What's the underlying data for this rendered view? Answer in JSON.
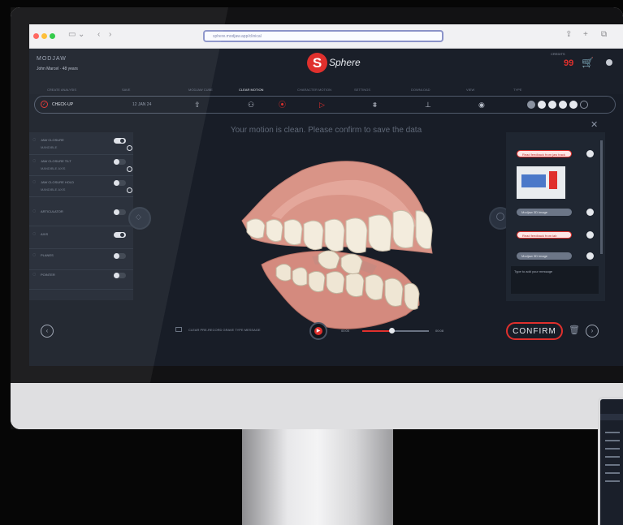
{
  "browser": {
    "url": "sphere.modjaw.app/clinical",
    "nav_icons": {
      "sidebar": "sidebar-icon",
      "back": "chevron-left-icon",
      "forward": "chevron-right-icon"
    },
    "right_icons": [
      "share-icon",
      "new-tab-icon",
      "tabs-icon"
    ],
    "glyphs": {
      "sidebar": "▭",
      "back": "‹",
      "forward": "›",
      "share": "⇪",
      "new_tab": "+",
      "tabs": "⧉"
    }
  },
  "app": {
    "brand": "MODJAW",
    "patient": "John Marcel · 48 years",
    "logo_letter": "S",
    "logo_text": "Sphere",
    "counter_label": "CREDITS",
    "counter_value": "99",
    "cart_glyph": "🛒",
    "accent_color": "#e0302d"
  },
  "steps": {
    "labels": [
      "CREATE ANALYSIS",
      "SAVE",
      "MODJAW CUBE",
      "CLEAR MOTION",
      "CHARACTER MOTION",
      "SETTINGS",
      "DOWNLOAD",
      "VIEW",
      "TYPE"
    ],
    "active_index": 3,
    "current": "CHECK-UP",
    "date": "12 JAN 24",
    "icons": [
      "upload-icon",
      "motion-icon",
      "record-icon",
      "play-icon",
      "teeth-icon",
      "jaw-icon",
      "eye-icon"
    ],
    "glyphs": [
      "⇧",
      "⚇",
      "⦿",
      "▷",
      "⩩",
      "⊥",
      "◉"
    ]
  },
  "left_panel": {
    "rows": [
      {
        "label": "JAW CLOSURE",
        "sub": "MANDIBLE",
        "on": true
      },
      {
        "label": "JAW CLOSURE TILT",
        "sub": "MANDIBLE AXIS",
        "on": false
      },
      {
        "label": "JAW CLOSURE HOLD",
        "sub": "MANDIBLE AXIS",
        "on": false
      },
      {
        "label": "ARTICULATOR",
        "sub": "",
        "on": false
      },
      {
        "label": "AXIS",
        "sub": "",
        "on": true
      },
      {
        "label": "PLANES",
        "sub": "",
        "on": false
      },
      {
        "label": "POINTER",
        "sub": "",
        "on": false
      }
    ]
  },
  "viewer": {
    "message": "Your motion is clean. Please confirm to save the data"
  },
  "right_panel": {
    "messages": [
      {
        "kind": "red",
        "text": "Read feedback from jaw track"
      },
      {
        "kind": "gray",
        "text": "Modjaw 3D image"
      },
      {
        "kind": "red",
        "text": "Read feedback from lab"
      },
      {
        "kind": "gray",
        "text": "Modjaw 3D image"
      }
    ],
    "input_placeholder": "Type to add your message"
  },
  "controls": {
    "checkbox_label": "CLEAR PRE-RECORD GRAVE TYPE MESSAGE",
    "time_start": "00:00",
    "time_end": "00:08",
    "progress": 0.44,
    "confirm_label": "CONFIRM"
  }
}
